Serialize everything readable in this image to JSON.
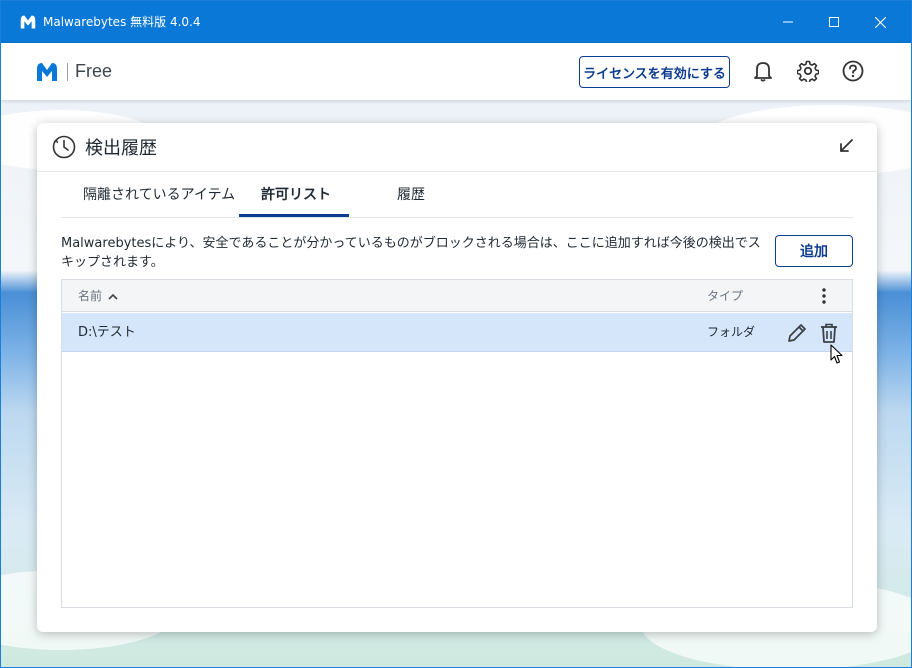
{
  "window": {
    "title": "Malwarebytes 無料版  4.0.4",
    "controls": {
      "minimize": "minimize-icon",
      "maximize": "maximize-icon",
      "close": "close-icon"
    }
  },
  "header": {
    "edition": "Free",
    "license_button": "ライセンスを有効にする",
    "icons": [
      "bell-icon",
      "gear-icon",
      "help-icon"
    ]
  },
  "panel": {
    "title": "検出履歴",
    "tabs": [
      {
        "label": "隔離されているアイテム",
        "active": false
      },
      {
        "label": "許可リスト",
        "active": true
      },
      {
        "label": "履歴",
        "active": false
      }
    ],
    "description": "Malwarebytesにより、安全であることが分かっているものがブロックされる場合は、ここに追加すれば今後の検出でスキップされます。",
    "add_button": "追加",
    "table": {
      "columns": {
        "name": "名前",
        "type": "タイプ"
      },
      "rows": [
        {
          "name": "D:\\テスト",
          "type": "フォルダ"
        }
      ]
    }
  },
  "colors": {
    "titlebar": "#0a78d7",
    "accent": "#0d3c8f",
    "selected_row": "#d6e6fa"
  }
}
